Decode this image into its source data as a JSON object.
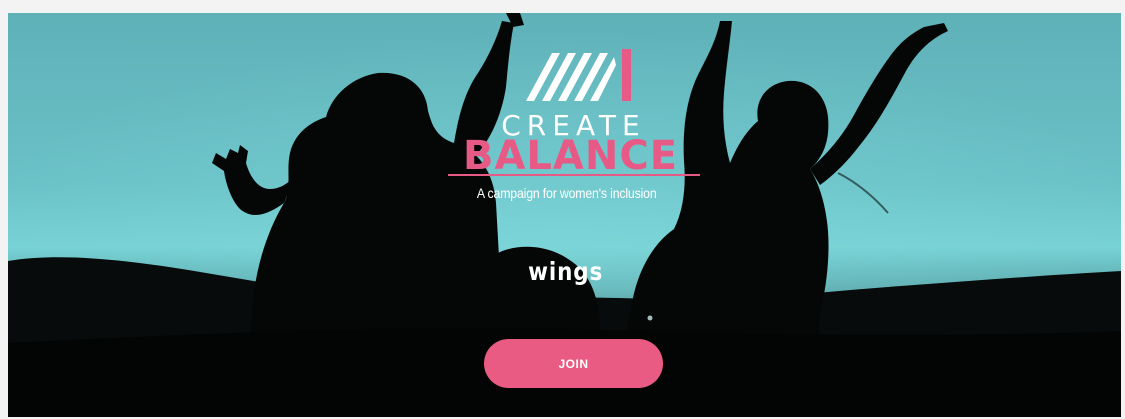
{
  "banner": {
    "title_line1": "CREATE",
    "title_line2": "BALANCE",
    "tagline": "A campaign for women's inclusion",
    "partner_logo": "wings",
    "join_label": "JOIN"
  },
  "colors": {
    "accent": "#e95b82",
    "sky": "#6ac1c6",
    "silhouette": "#050707",
    "page_background": "#f3f3f3"
  },
  "icons": {
    "campaign_logo": "create-balance-logo-icon"
  }
}
